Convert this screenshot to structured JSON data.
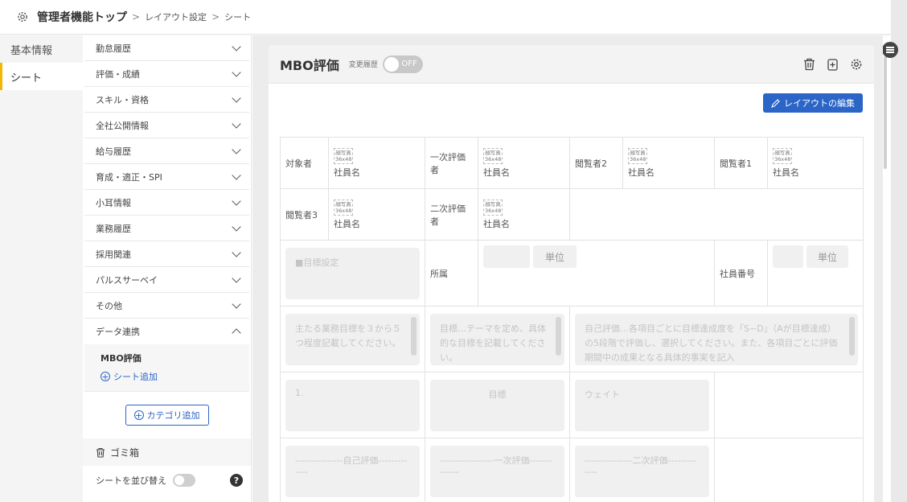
{
  "breadcrumb": {
    "home": "管理者機能トップ",
    "sep": ">",
    "items": [
      "レイアウト設定",
      "シート"
    ]
  },
  "leftnav": {
    "items": [
      {
        "label": "基本情報",
        "active": false
      },
      {
        "label": "シート",
        "active": true
      }
    ]
  },
  "categories": [
    {
      "label": "勤怠履歴"
    },
    {
      "label": "評価・成績"
    },
    {
      "label": "スキル・資格"
    },
    {
      "label": "全社公開情報"
    },
    {
      "label": "給与履歴"
    },
    {
      "label": "育成・適正・SPI"
    },
    {
      "label": "小耳情報"
    },
    {
      "label": "業務履歴"
    },
    {
      "label": "採用関連"
    },
    {
      "label": "パルスサーベイ"
    },
    {
      "label": "その他"
    },
    {
      "label": "データ連携"
    }
  ],
  "subsheet": {
    "active": "MBO評価",
    "add": "シート追加"
  },
  "category_add": "カテゴリ追加",
  "trash": "ゴミ箱",
  "sort_label": "シートを並び替え",
  "help": "?",
  "card": {
    "title": "MBO評価",
    "history_label": "変更履歴",
    "toggle": "OFF",
    "edit_button": "レイアウトの編集"
  },
  "photo": {
    "line1": "顔写真",
    "line2": "36x48"
  },
  "sheet": {
    "r1": [
      {
        "label": "対象者",
        "name": "社員名"
      },
      {
        "label": "一次評価者",
        "name": "社員名"
      },
      {
        "label": "閲覧者2",
        "name": "社員名"
      },
      {
        "label": "閲覧者1",
        "name": "社員名"
      }
    ],
    "r2": [
      {
        "label": "閲覧者3",
        "name": "社員名"
      },
      {
        "label": "二次評価者",
        "name": "社員名"
      }
    ],
    "goal_setting": "■目標設定",
    "dept_label": "所属",
    "unit": "単位",
    "emp_no_label": "社員番号",
    "desc1": "主たる業務目標を３から５つ程度記載してください。",
    "desc2": "目標…テーマを定め、具体的な目標を記載してください。",
    "desc3": "自己評価…各項目ごとに目標達成度を「S~D」（Aが目標達成）の5段階で評価し、選択してください。また、各項目ごとに評価期間中の成果となる具体的事実を記入",
    "num": "1.",
    "goal": "目標",
    "weight": "ウェイト",
    "self_eval": "---------------自己評価-------------",
    "first_eval": "-----------------一次評価-------------",
    "second_eval": "---------------二次評価-------------"
  }
}
